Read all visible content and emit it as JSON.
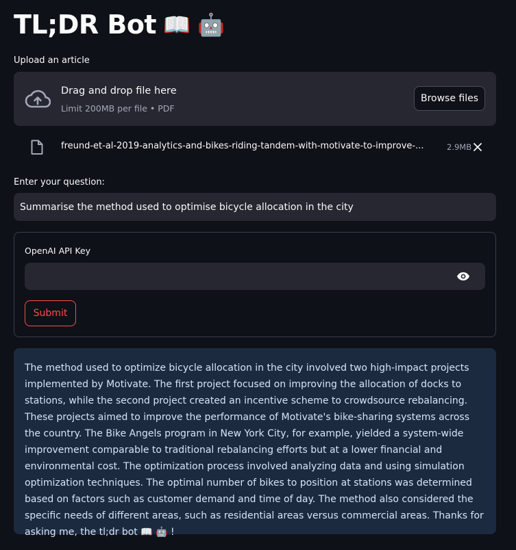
{
  "header": {
    "title": "TL;DR Bot",
    "title_emoji": "📖 🤖"
  },
  "uploader": {
    "label": "Upload an article",
    "drag_title": "Drag and drop file here",
    "drag_sub": "Limit 200MB per file • PDF",
    "browse_label": "Browse files",
    "icon": "cloud-upload-icon"
  },
  "uploaded_file": {
    "name": "freund-et-al-2019-analytics-and-bikes-riding-tandem-with-motivate-to-improve-...",
    "size": "2.9MB",
    "icon": "file-icon"
  },
  "question": {
    "label": "Enter your question:",
    "value": "Summarise the method used to optimise bicycle allocation in the city"
  },
  "form": {
    "api_label": "OpenAI API Key",
    "api_value": "",
    "submit_label": "Submit"
  },
  "answer": {
    "text": "The method used to optimize bicycle allocation in the city involved two high-impact projects implemented by Motivate. The first project focused on improving the allocation of docks to stations, while the second project created an incentive scheme to crowdsource rebalancing. These projects aimed to improve the performance of Motivate's bike-sharing systems across the country. The Bike Angels program in New York City, for example, yielded a system-wide improvement comparable to traditional rebalancing efforts but at a lower financial and environmental cost. The optimization process involved analyzing data and using simulation optimization techniques. The optimal number of bikes to position at stations was determined based on factors such as customer demand and time of day. The method also considered the specific needs of different areas, such as residential areas versus commercial areas. Thanks for asking me, the tl;dr bot 📖 🤖 !"
  },
  "colors": {
    "background": "#0e1117",
    "input_bg": "#262730",
    "accent": "#ff4b4b",
    "answer_bg": "#1c2a40"
  }
}
